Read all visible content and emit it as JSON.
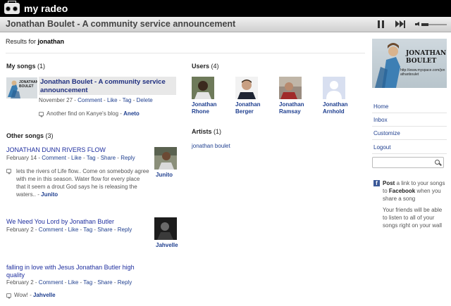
{
  "app": {
    "title": "my radeo"
  },
  "now_playing": {
    "title": "Jonathan Boulet - A community service announcement"
  },
  "results": {
    "prefix": "Results for ",
    "query": "jonathan"
  },
  "my_songs": {
    "heading": "My songs",
    "count": "(1)",
    "song": {
      "title": "Jonathan Boulet - A community service announcement",
      "date": "November 27",
      "actions": [
        "Comment",
        "Like",
        "Tag",
        "Delete"
      ],
      "comment_text": "Another find on Kanye's blog",
      "comment_user": "Aneto"
    },
    "thumb_text": "JONATHAN BOULET"
  },
  "other_songs": {
    "heading": "Other songs",
    "count": "(3)",
    "items": [
      {
        "title": "JONATHAN DUNN RIVERS FLOW",
        "date": "February 14",
        "actions": [
          "Comment",
          "Like",
          "Tag",
          "Share",
          "Reply"
        ],
        "desc": "lets the rivers of Life flow.. Come on somebody agree with me in this season. Water flow for every place that it seem a drout God says he is releasing the waters..",
        "desc_user": "Junito",
        "poster": "Junito"
      },
      {
        "title": "We Need You Lord by Jonathan Butler",
        "date": "February 2",
        "actions": [
          "Comment",
          "Like",
          "Tag",
          "Share",
          "Reply"
        ],
        "poster": "Jahvelle"
      },
      {
        "title": "falling in love with Jesus Jonathan Butler high quality",
        "date": "February 2",
        "actions": [
          "Comment",
          "Like",
          "Tag",
          "Share",
          "Reply"
        ],
        "comment_text": "Wow!",
        "comment_user": "Jahvelle"
      }
    ]
  },
  "users": {
    "heading": "Users",
    "count": "(4)",
    "items": [
      {
        "first": "Jonathan",
        "last": "Rhone"
      },
      {
        "first": "Jonathan",
        "last": "Berger"
      },
      {
        "first": "Jonathan",
        "last": "Ramsay"
      },
      {
        "first": "Jonathan",
        "last": "Arnhold"
      }
    ]
  },
  "artists": {
    "heading": "Artists",
    "count": "(1)",
    "items": [
      "jonathan boulet"
    ]
  },
  "sidebar": {
    "cover_title": "JONATHAN BOULET",
    "cover_url": "http://www.myspace.com/jonathanboulet",
    "links": [
      "Home",
      "Inbox",
      "Customize",
      "Logout"
    ],
    "search_placeholder": "",
    "fb_bold": "Post",
    "fb_text1": " a link to your songs to ",
    "fb_bold2": "Facebook",
    "fb_text2": " when you share a song",
    "fb_note": "Your friends will be able to listen to all of your songs right on your wall"
  },
  "colors": {
    "link": "#1f3f8f",
    "topbar": "#000000",
    "facebook": "#3b5998"
  }
}
